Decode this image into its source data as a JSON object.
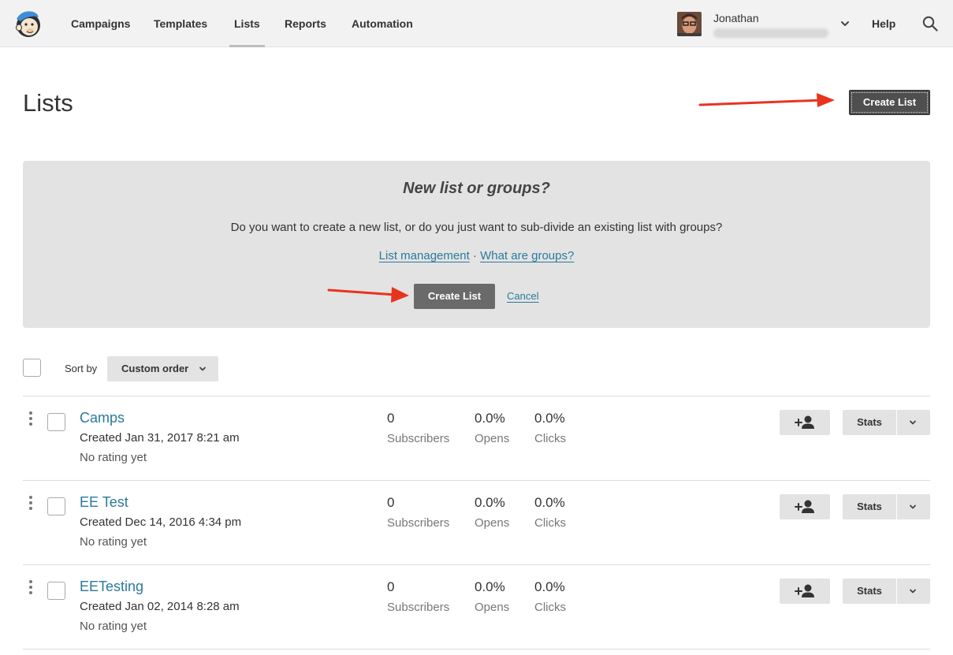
{
  "nav": {
    "items": [
      {
        "label": "Campaigns",
        "active": false
      },
      {
        "label": "Templates",
        "active": false
      },
      {
        "label": "Lists",
        "active": true
      },
      {
        "label": "Reports",
        "active": false
      },
      {
        "label": "Automation",
        "active": false
      }
    ],
    "user_name": "Jonathan",
    "help": "Help",
    "icons": {
      "logo": "mailchimp-logo",
      "search": "search-icon",
      "user_menu": "chevron-down-icon"
    }
  },
  "page": {
    "title": "Lists",
    "create_button": "Create List"
  },
  "panel": {
    "title": "New list or groups?",
    "text": "Do you want to create a new list, or do you just want to sub-divide an existing list with groups?",
    "link_management": "List management",
    "separator": "·",
    "link_groups": "What are groups?",
    "create_button": "Create List",
    "cancel": "Cancel"
  },
  "sort": {
    "label": "Sort by",
    "selected": "Custom order"
  },
  "lists": [
    {
      "name": "Camps",
      "created": "Created Jan 31, 2017 8:21 am",
      "rating": "No rating yet",
      "subscribers": "0",
      "subscribers_label": "Subscribers",
      "opens": "0.0%",
      "opens_label": "Opens",
      "clicks": "0.0%",
      "clicks_label": "Clicks",
      "stats_label": "Stats"
    },
    {
      "name": "EE Test",
      "created": "Created Dec 14, 2016 4:34 pm",
      "rating": "No rating yet",
      "subscribers": "0",
      "subscribers_label": "Subscribers",
      "opens": "0.0%",
      "opens_label": "Opens",
      "clicks": "0.0%",
      "clicks_label": "Clicks",
      "stats_label": "Stats"
    },
    {
      "name": "EETesting",
      "created": "Created Jan 02, 2014 8:28 am",
      "rating": "No rating yet",
      "subscribers": "0",
      "subscribers_label": "Subscribers",
      "opens": "0.0%",
      "opens_label": "Opens",
      "clicks": "0.0%",
      "clicks_label": "Clicks",
      "stats_label": "Stats"
    }
  ],
  "colors": {
    "link": "#2a7a9c",
    "annotation_arrow": "#e8341f",
    "button_dark": "#4f4f4f",
    "panel_bg": "#e3e3e3"
  }
}
